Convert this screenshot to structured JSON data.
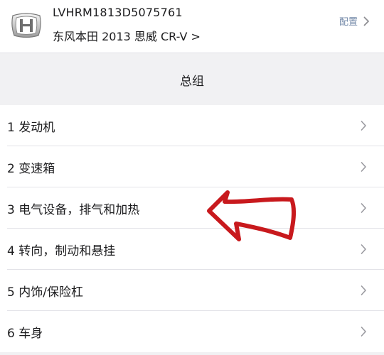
{
  "vehicle": {
    "vin": "LVHRM1813D5075761",
    "model": "东风本田 2013 思威 CR-V >",
    "config_label": "配置",
    "logo_icon": "honda-logo-icon"
  },
  "section": {
    "title": "总组"
  },
  "groups": [
    {
      "label": "1 发动机"
    },
    {
      "label": "2 变速箱"
    },
    {
      "label": "3 电气设备，排气和加热"
    },
    {
      "label": "4 转向，制动和悬挂"
    },
    {
      "label": "5 内饰/保险杠"
    },
    {
      "label": "6 车身"
    }
  ],
  "colors": {
    "accent_link": "#6f86a6",
    "annotation": "#c8191d"
  }
}
